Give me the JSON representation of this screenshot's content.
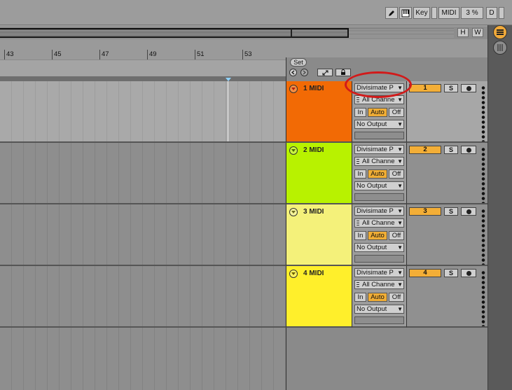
{
  "toolbar": {
    "key_label": "Key",
    "midi_label": "MIDI",
    "cpu_label": "3 %",
    "d_label": "D",
    "h_label": "H",
    "w_label": "W",
    "pencil_icon": "pencil-icon",
    "keyboard_icon": "piano-keys-icon"
  },
  "ruler": {
    "ticks": [
      "43",
      "45",
      "47",
      "49",
      "51",
      "53"
    ]
  },
  "set_area": {
    "set_label": "Set"
  },
  "tracks": [
    {
      "name": "1 MIDI",
      "color": "#f26a05",
      "input_type": "Divisimate P",
      "channel": "All Channe",
      "monitor_in": "In",
      "monitor_auto": "Auto",
      "monitor_off": "Off",
      "output": "No Output",
      "arm_number": "1",
      "solo": "S"
    },
    {
      "name": "2 MIDI",
      "color": "#b8f200",
      "input_type": "Divisimate P",
      "channel": "All Channe",
      "monitor_in": "In",
      "monitor_auto": "Auto",
      "monitor_off": "Off",
      "output": "No Output",
      "arm_number": "2",
      "solo": "S"
    },
    {
      "name": "3 MIDI",
      "color": "#f4f17a",
      "input_type": "Divisimate P",
      "channel": "All Channe",
      "monitor_in": "In",
      "monitor_auto": "Auto",
      "monitor_off": "Off",
      "output": "No Output",
      "arm_number": "3",
      "solo": "S"
    },
    {
      "name": "4 MIDI",
      "color": "#ffef2b",
      "input_type": "Divisimate P",
      "channel": "All Channe",
      "monitor_in": "In",
      "monitor_auto": "Auto",
      "monitor_off": "Off",
      "output": "No Output",
      "arm_number": "4",
      "solo": "S"
    }
  ],
  "accent": {
    "arm_orange": "#f3ae37",
    "callout_red": "#d21a1a"
  }
}
